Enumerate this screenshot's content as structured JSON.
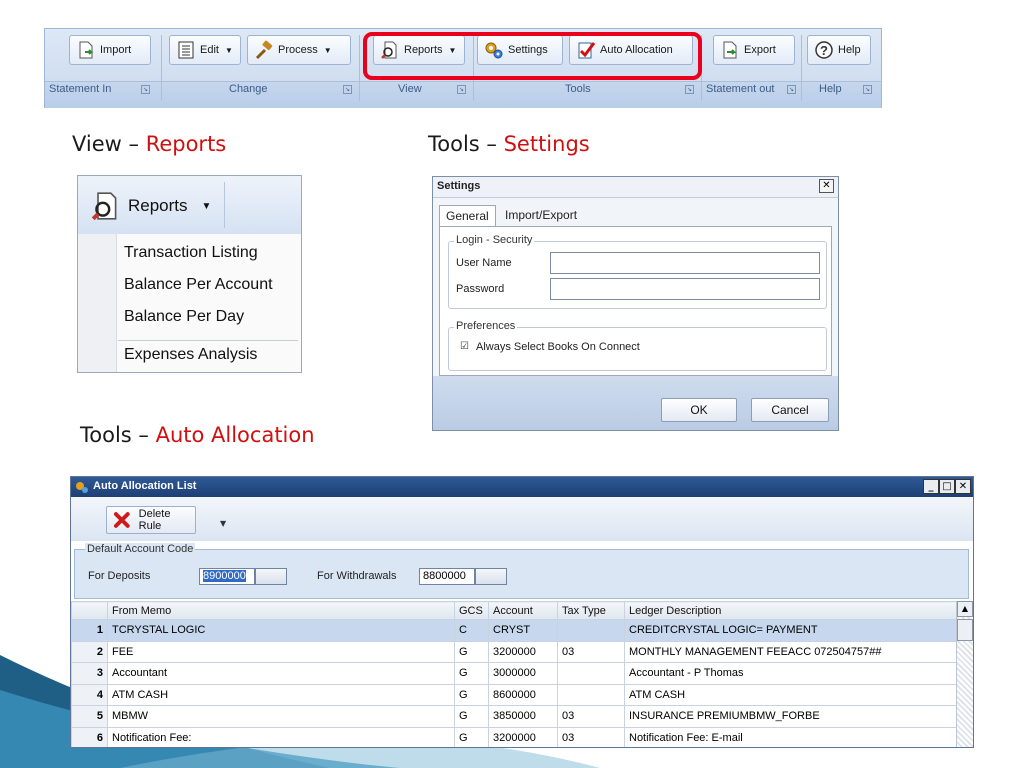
{
  "ribbon": {
    "buttons": {
      "import": "Import",
      "edit": "Edit",
      "process": "Process",
      "reports": "Reports",
      "settings": "Settings",
      "auto_allocation": "Auto Allocation",
      "export": "Export",
      "help": "Help"
    },
    "groups": {
      "statement_in": "Statement In",
      "change": "Change",
      "view": "View",
      "tools": "Tools",
      "statement_out": "Statement out",
      "help": "Help"
    }
  },
  "headings": {
    "view_prefix": "View – ",
    "view_accent": "Reports",
    "settings_prefix": "Tools – ",
    "settings_accent": "Settings",
    "auto_prefix": "Tools – ",
    "auto_accent": "Auto Allocation"
  },
  "reports_menu": {
    "button": "Reports",
    "items": [
      "Transaction Listing",
      "Balance Per Account",
      "Balance Per Day",
      "Expenses Analysis"
    ]
  },
  "settings_dialog": {
    "title": "Settings",
    "tabs": [
      "General",
      "Import/Export"
    ],
    "login_group": "Login - Security",
    "user_name_label": "User Name",
    "password_label": "Password",
    "user_name_value": "",
    "password_value": "",
    "preferences_group": "Preferences",
    "always_select_books": "Always Select Books On Connect",
    "always_select_books_checked": true,
    "ok": "OK",
    "cancel": "Cancel"
  },
  "auto_allocation": {
    "title": "Auto Allocation List",
    "delete_rule": "Delete Rule",
    "default_account_code": "Default Account Code",
    "for_deposits_label": "For Deposits",
    "for_deposits_value": "8900000",
    "for_withdrawals_label": "For Withdrawals",
    "for_withdrawals_value": "8800000",
    "columns": [
      "From Memo",
      "GCS",
      "Account",
      "Tax Type",
      "Ledger Description"
    ],
    "rows": [
      {
        "n": "1",
        "memo": "TCRYSTAL LOGIC",
        "gcs": "C",
        "account": "CRYST",
        "tax": "",
        "desc": "CREDITCRYSTAL LOGIC= PAYMENT"
      },
      {
        "n": "2",
        "memo": "FEE",
        "gcs": "G",
        "account": "3200000",
        "tax": "03",
        "desc": "MONTHLY MANAGEMENT FEEACC  072504757##"
      },
      {
        "n": "3",
        "memo": "Accountant",
        "gcs": "G",
        "account": "3000000",
        "tax": "",
        "desc": "Accountant - P Thomas"
      },
      {
        "n": "4",
        "memo": "ATM CASH",
        "gcs": "G",
        "account": "8600000",
        "tax": "",
        "desc": "ATM CASH"
      },
      {
        "n": "5",
        "memo": "MBMW",
        "gcs": "G",
        "account": "3850000",
        "tax": "03",
        "desc": "INSURANCE PREMIUMBMW_FORBE"
      },
      {
        "n": "6",
        "memo": "Notification Fee:",
        "gcs": "G",
        "account": "3200000",
        "tax": "03",
        "desc": "Notification Fee: E-mail"
      }
    ]
  },
  "colors": {
    "highlight": "#e8001c",
    "accent_text": "#d10f0f",
    "title_bar": "#1d3f74"
  }
}
